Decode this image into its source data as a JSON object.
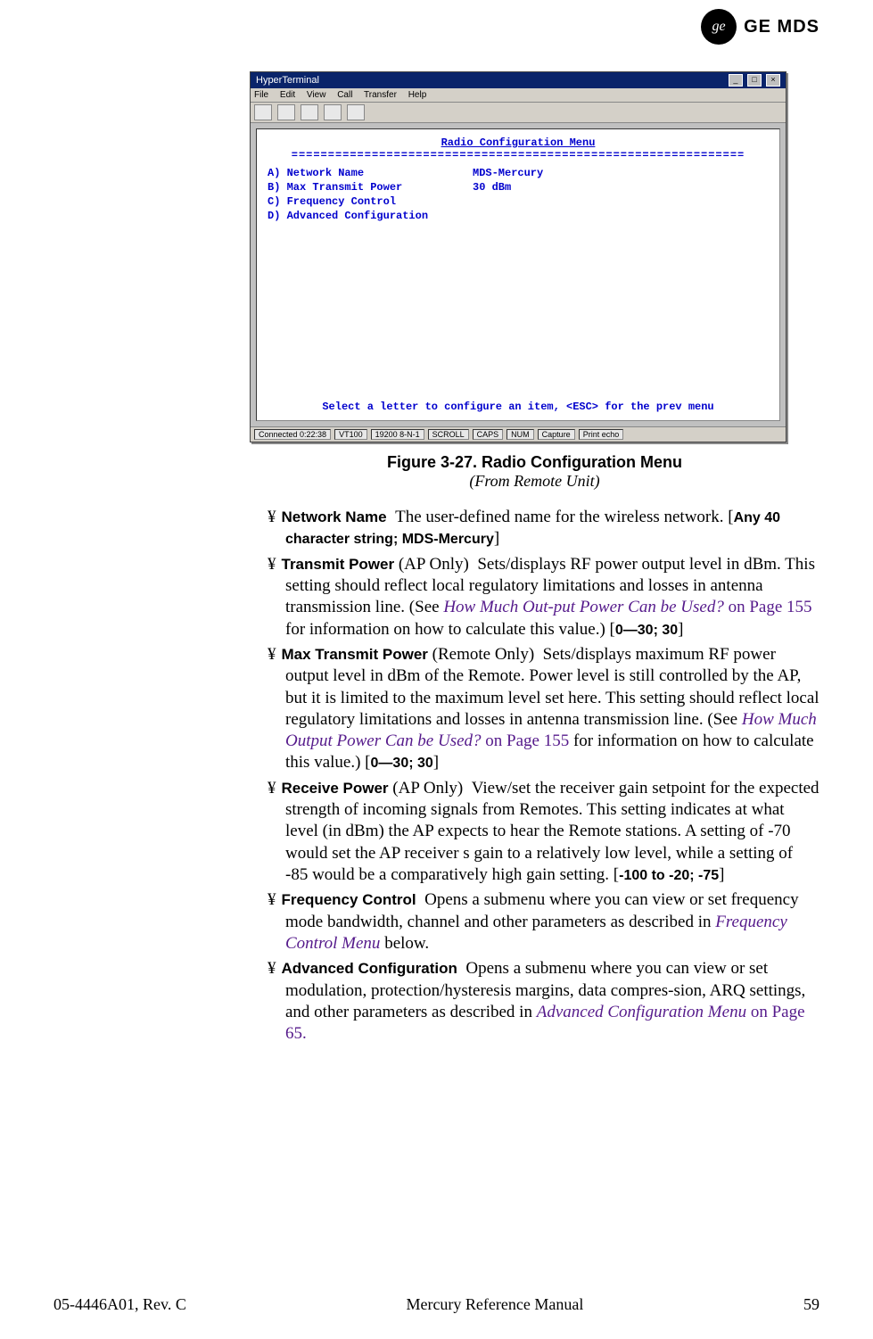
{
  "header": {
    "brand": "GE MDS",
    "logo_text": "ge"
  },
  "window": {
    "titlebar": "HyperTerminal",
    "menubar": [
      "File",
      "Edit",
      "View",
      "Call",
      "Transfer",
      "Help"
    ],
    "terminal_title": "Radio Configuration Menu",
    "items": [
      {
        "key": "A)",
        "label": "Network Name",
        "value": "MDS-Mercury"
      },
      {
        "key": "B)",
        "label": "Max Transmit Power",
        "value": "30 dBm"
      },
      {
        "key": "C)",
        "label": "Frequency Control",
        "value": ""
      },
      {
        "key": "D)",
        "label": "Advanced Configuration",
        "value": ""
      }
    ],
    "prompt": "Select a letter to configure an item, <ESC> for the prev menu",
    "statusbar": [
      "Connected 0:22:38",
      "VT100",
      "19200 8-N-1",
      "SCROLL",
      "CAPS",
      "NUM",
      "Capture",
      "Print echo"
    ]
  },
  "figure": {
    "number": "Figure 3-27. Radio Configuration Menu",
    "subtitle": "(From Remote Unit)"
  },
  "bullets": {
    "marker": "¥",
    "network_name_label": "Network Name",
    "network_name_text": "The user-defined name for the wireless network.",
    "network_name_constraint": "Any 40 character string; MDS-Mercury",
    "transmit_power_label": "Transmit Power",
    "transmit_power_note": " (AP Only)",
    "transmit_power_text1": "Sets/displays RF power output level in dBm. This setting should reflect local regulatory limitations and losses in antenna transmission line. (See ",
    "transmit_power_link": "How Much Out-put Power Can be Used?",
    "transmit_power_page": " on Page 155",
    "transmit_power_text2": " for information on how to calculate this value.) [",
    "transmit_power_constraint": "0—30; 30",
    "max_transmit_label": "Max Transmit Power",
    "max_transmit_note": " (Remote Only)",
    "max_transmit_text1": "Sets/displays maximum RF power output level in dBm of the Remote. Power level is still controlled by the AP, but it is limited to the maximum level set here. This setting should reflect local regulatory limitations and losses in antenna transmission line. (See ",
    "max_transmit_link": "How Much Output Power Can be Used?",
    "max_transmit_page": " on Page 155",
    "max_transmit_text2": " for information on how to calculate this value.) [",
    "max_transmit_constraint": "0—30; 30",
    "receive_power_label": "Receive Power",
    "receive_power_note": " (AP Only)",
    "receive_power_text": "View/set the receiver gain setpoint for the expected strength of incoming signals from Remotes. This setting indicates at what level (in dBm) the AP expects to hear the Remote stations. A setting of -70 would set the AP receiver s gain to a relatively low level, while a setting of -85 would be a comparatively high gain setting. [",
    "receive_power_constraint": "-100 to -20; -75",
    "freq_label": "Frequency Control",
    "freq_text1": "Opens a submenu where you can view or set frequency mode bandwidth, channel and other parameters as described in ",
    "freq_link": "Frequency Control Menu",
    "freq_text2": " below.",
    "adv_label": "Advanced Configuration",
    "adv_text1": "Opens a submenu where you can view or set modulation, protection/hysteresis margins, data compres-sion, ARQ settings, and other parameters as described in ",
    "adv_link": "Advanced Configuration Menu",
    "adv_page": " on Page 65."
  },
  "footer": {
    "left": "05-4446A01, Rev. C",
    "center": "Mercury Reference Manual",
    "right": "59"
  }
}
